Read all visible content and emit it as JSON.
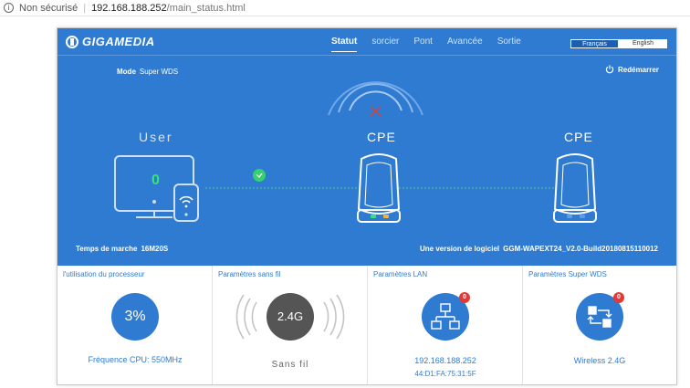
{
  "browser": {
    "security_label": "Non sécurisé",
    "host": "192.168.188.252",
    "path": "/main_status.html"
  },
  "header": {
    "logo_text": "GIGAMEDIA",
    "nav": [
      "Statut",
      "sorcier",
      "Pont",
      "Avancée",
      "Sortie"
    ],
    "lang_fr": "Français",
    "lang_en": "English"
  },
  "status": {
    "mode_label": "Mode",
    "mode_value": "Super WDS",
    "reboot_label": "Redémarrer",
    "user_label": "User",
    "user_count": "0",
    "cpe1_label": "CPE",
    "cpe2_label": "CPE",
    "uptime_label": "Temps de marche",
    "uptime_value": "16M20S",
    "fw_label": "Une version de logiciel",
    "fw_value": "GGM-WAPEXT24_V2.0-Build20180815110012"
  },
  "cards": {
    "cpu": {
      "title": "l'utilisation du processeur",
      "value": "3%",
      "foot": "Fréquence CPU: 550MHz"
    },
    "wireless": {
      "title": "Paramètres sans fil",
      "value": "2.4G",
      "foot": "Sans fil"
    },
    "lan": {
      "title": "Paramètres LAN",
      "badge": "0",
      "ip": "192.168.188.252",
      "mac": "44:D1:FA:75:31:5F"
    },
    "wds": {
      "title": "Paramètres Super WDS",
      "badge": "0",
      "foot": "Wireless 2.4G"
    }
  },
  "colors": {
    "hero": "#2e7bd1",
    "accent": "#2e7bd1",
    "ok": "#36e27b",
    "badge": "#e53935"
  }
}
